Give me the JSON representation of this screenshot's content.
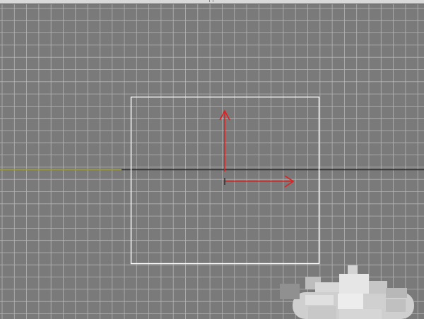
{
  "viewport": {
    "view_name": "",
    "background_color": "#7a7a7a",
    "grid_color": "#b4b4b4",
    "horizon_color": "#2a2a2a",
    "axis_tail_color": "#9a9a4a",
    "selection_color": "#ffffff",
    "gizmo_color": "#e02020",
    "top_strip_color": "#d9d9d9"
  },
  "icons": {
    "gizmo_x": "arrow-right-icon",
    "gizmo_y": "arrow-up-icon"
  }
}
